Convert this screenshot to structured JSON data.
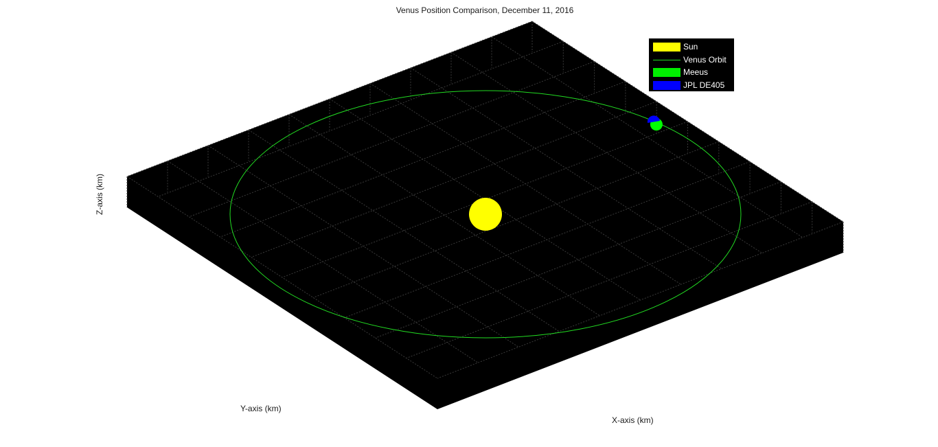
{
  "chart_data": {
    "type": "scatter",
    "title": "Venus Position Comparison, December 11, 2016",
    "xlabel": "X-axis (km)",
    "ylabel": "Y-axis (km)",
    "zlabel": "Z-axis (km)",
    "view": "3d",
    "grid": true,
    "background_color": "#000000",
    "legend_position": "top-right",
    "series": [
      {
        "name": "Sun",
        "kind": "sphere",
        "color": "#ffff00",
        "position": [
          0,
          0,
          0
        ]
      },
      {
        "name": "Venus Orbit",
        "kind": "line",
        "color": "#22dd22",
        "orbit_semi_axis": 1.0
      },
      {
        "name": "Meeus",
        "kind": "sphere",
        "color": "#00ff00",
        "orbit_angle_deg": 48.0
      },
      {
        "name": "JPL DE405",
        "kind": "sphere",
        "color": "#0000ff",
        "orbit_angle_deg": 48.6
      }
    ]
  }
}
